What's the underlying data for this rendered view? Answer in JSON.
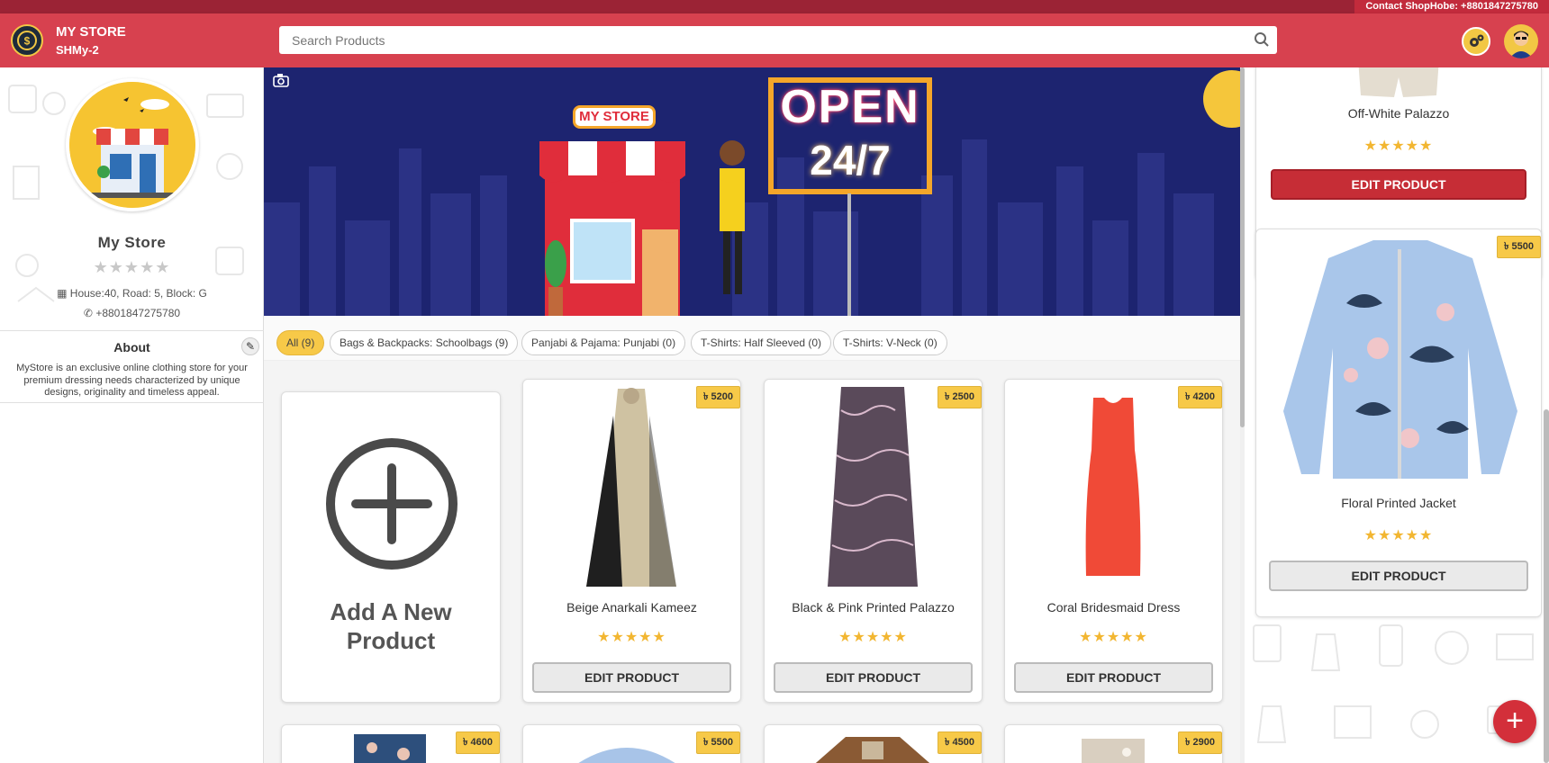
{
  "contact": "Contact ShopHobe: +8801847275780",
  "header": {
    "store_name": "MY STORE",
    "store_code": "SHMy-2",
    "search_placeholder": "Search Products"
  },
  "sidebar": {
    "title": "My Store",
    "rating_stars": "★★★★★",
    "address": "House:40, Road: 5, Block: G",
    "phone": "+8801847275780",
    "about_title": "About",
    "about_text": "MyStore is an exclusive online clothing store for your premium dressing needs characterized by unique designs, originality and timeless appeal."
  },
  "banner": {
    "store_sign": "MY STORE",
    "open_line1": "OPEN",
    "open_line2": "24/7"
  },
  "categories": [
    "All (9)",
    "Bags & Backpacks: Schoolbags (9)",
    "Panjabi & Pajama: Punjabi (0)",
    "T-Shirts: Half Sleeved (0)",
    "T-Shirts: V-Neck (0)"
  ],
  "add_product": {
    "label_line1": "Add A New",
    "label_line2": "Product"
  },
  "edit_label": "EDIT PRODUCT",
  "stars": "★★★★★",
  "currency_symbol": "৳",
  "products": [
    {
      "name": "Beige Anarkali Kameez",
      "price": "৳ 5200"
    },
    {
      "name": "Black & Pink Printed Palazzo",
      "price": "৳ 2500"
    },
    {
      "name": "Coral Bridesmaid Dress",
      "price": "৳ 4200"
    }
  ],
  "products_row2": [
    {
      "price": "৳ 4600"
    },
    {
      "price": "৳ 5500"
    },
    {
      "price": "৳ 4500"
    },
    {
      "price": "৳ 2900"
    }
  ],
  "right_products": [
    {
      "name": "Off-White Palazzo"
    },
    {
      "name": "Floral Printed Jacket",
      "price": "৳ 5500"
    }
  ],
  "fab_label": "+",
  "colors": {
    "brand_red": "#d7414f",
    "accent_yellow": "#f7c948",
    "banner_navy": "#1d2470"
  }
}
